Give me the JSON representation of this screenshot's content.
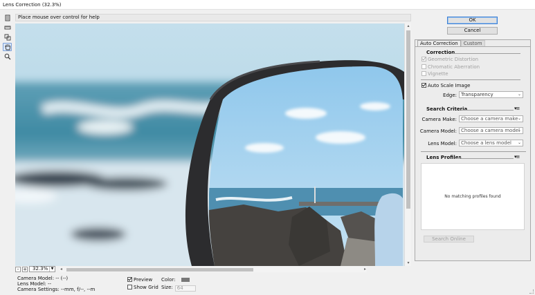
{
  "window": {
    "title": "Lens Correction (32.3%)"
  },
  "tools": [
    {
      "name": "remove-distortion-tool-icon",
      "active": false
    },
    {
      "name": "straighten-tool-icon",
      "active": false
    },
    {
      "name": "move-grid-tool-icon",
      "active": false
    },
    {
      "name": "hand-tool-icon",
      "active": true
    },
    {
      "name": "zoom-tool-icon",
      "active": false
    }
  ],
  "help": {
    "text": "Place mouse over control for help"
  },
  "zoom": {
    "minus": "-",
    "plus": "+",
    "value": "32.3%"
  },
  "info": {
    "camera_model": "Camera Model: -- (--)",
    "lens_model": "Lens Model: --",
    "camera_settings": "Camera Settings: --mm, f/--, --m"
  },
  "options": {
    "preview_label": "Preview",
    "preview_checked": true,
    "grid_label": "Show Grid",
    "grid_checked": false,
    "color_label": "Color:",
    "grid_color": "#777777",
    "size_label": "Size:",
    "size_value": "64"
  },
  "buttons": {
    "ok": "OK",
    "cancel": "Cancel"
  },
  "tabs": {
    "auto": "Auto Correction",
    "custom": "Custom"
  },
  "correction": {
    "title": "Correction",
    "geometric": "Geometric Distortion",
    "chromatic": "Chromatic Aberration",
    "vignette": "Vignette",
    "auto_scale": "Auto Scale Image",
    "edge_label": "Edge:",
    "edge_value": "Transparency"
  },
  "search": {
    "title": "Search Criteria",
    "camera_make_label": "Camera Make:",
    "camera_make_value": "Choose a camera make",
    "camera_model_label": "Camera Model:",
    "camera_model_value": "Choose a camera model",
    "lens_model_label": "Lens Model:",
    "lens_model_value": "Choose a lens model"
  },
  "profiles": {
    "title": "Lens Profiles",
    "empty": "No matching profiles found",
    "search_online": "Search Online"
  },
  "colors": {
    "accent": "#3c7fd3",
    "panel_border": "#a8a8a8"
  }
}
